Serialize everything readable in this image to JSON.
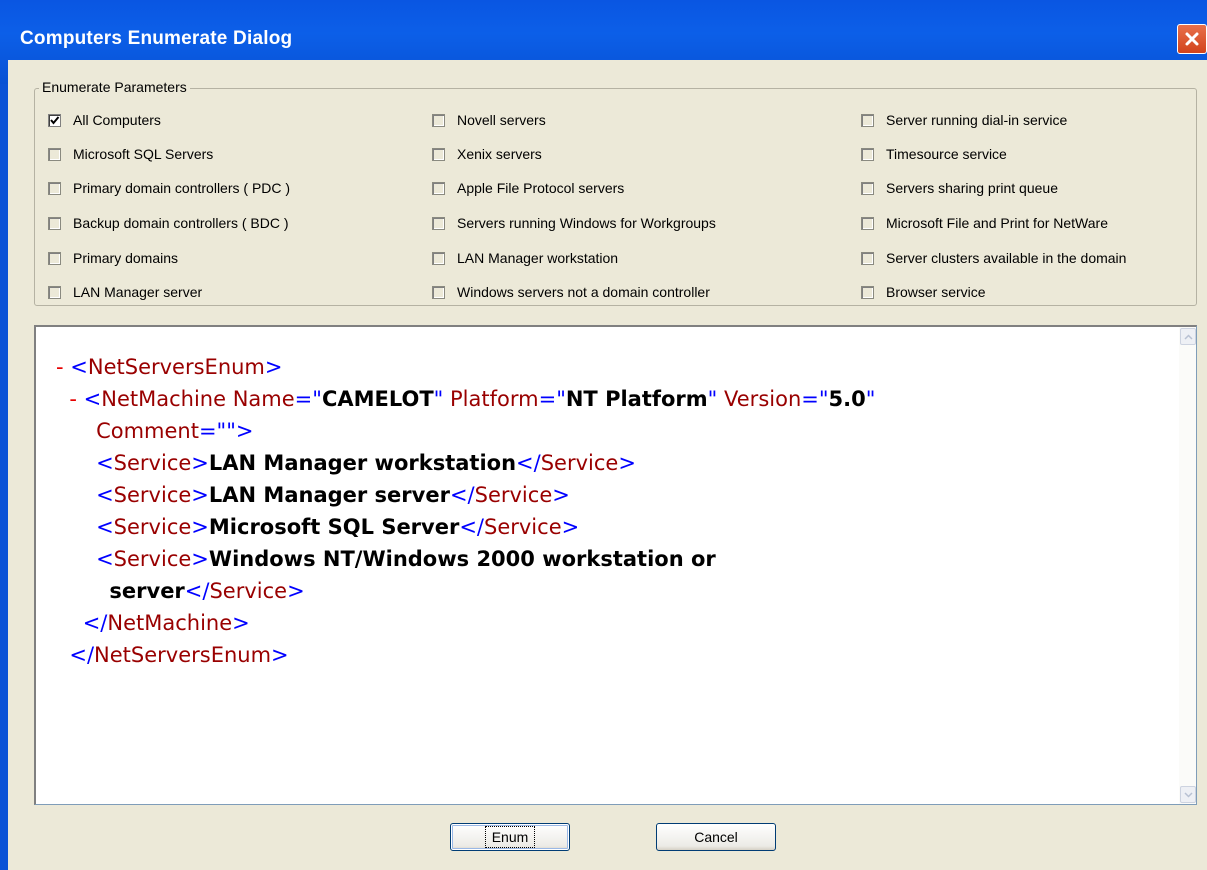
{
  "window": {
    "title": "Computers Enumerate Dialog"
  },
  "group": {
    "label": "Enumerate Parameters",
    "options": [
      {
        "label": "All Computers",
        "checked": true
      },
      {
        "label": "Microsoft SQL Servers",
        "checked": false
      },
      {
        "label": "Primary domain controllers ( PDC )",
        "checked": false
      },
      {
        "label": "Backup domain controllers ( BDC )",
        "checked": false
      },
      {
        "label": "Primary domains",
        "checked": false
      },
      {
        "label": "LAN Manager server",
        "checked": false
      },
      {
        "label": "Novell servers",
        "checked": false
      },
      {
        "label": "Xenix servers",
        "checked": false
      },
      {
        "label": "Apple File Protocol servers",
        "checked": false
      },
      {
        "label": "Servers running Windows for Workgroups",
        "checked": false
      },
      {
        "label": "LAN Manager workstation",
        "checked": false
      },
      {
        "label": "Windows servers not a domain controller",
        "checked": false
      },
      {
        "label": "Server running dial-in service",
        "checked": false
      },
      {
        "label": "Timesource service",
        "checked": false
      },
      {
        "label": "Servers sharing print queue",
        "checked": false
      },
      {
        "label": "Microsoft File and Print for NetWare",
        "checked": false
      },
      {
        "label": "Server clusters available in the domain",
        "checked": false
      },
      {
        "label": "Browser service",
        "checked": false
      }
    ]
  },
  "xml": {
    "minus": "-",
    "root_tag": "NetServersEnum",
    "machine_tag": "NetMachine",
    "attr_name": "Name",
    "attr_name_value": "CAMELOT",
    "attr_platform": "Platform",
    "attr_platform_value": "NT Platform",
    "attr_version": "Version",
    "attr_version_value": "5.0",
    "attr_comment": "Comment",
    "attr_comment_value": "",
    "service_tag": "Service",
    "services": [
      "LAN Manager workstation",
      "LAN Manager server",
      "Microsoft SQL Server",
      "Windows NT/Windows 2000 workstation or",
      "server"
    ]
  },
  "buttons": {
    "enum": "Enum",
    "cancel": "Cancel"
  },
  "colors": {
    "titlebar": "#0a56e2",
    "dialog_bg": "#ece9d8",
    "xml_tag": "#990000",
    "xml_bracket": "#0000ff",
    "xml_minus": "#e60000"
  }
}
